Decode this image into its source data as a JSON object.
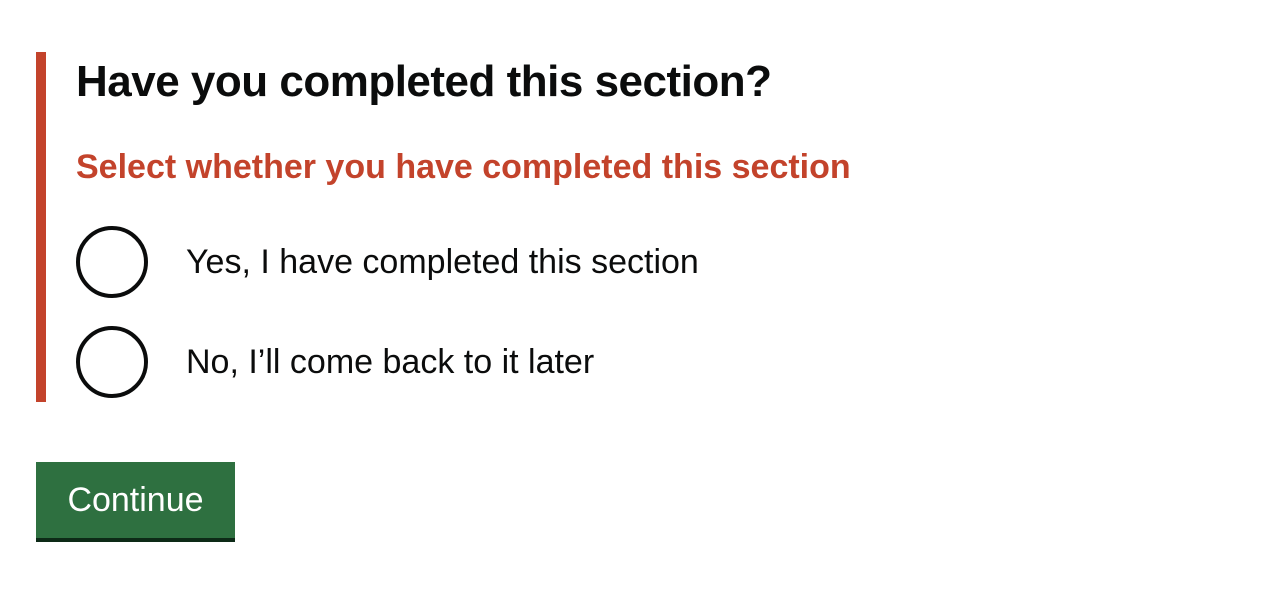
{
  "question": {
    "heading": "Have you completed this section?",
    "error_message": "Select whether you have completed this section"
  },
  "options": [
    {
      "label": "Yes, I have completed this section",
      "selected": false
    },
    {
      "label": "No, I’ll come back to it later",
      "selected": false
    }
  ],
  "actions": {
    "continue_label": "Continue"
  },
  "colors": {
    "error": "#c3432b",
    "button": "#2e7040",
    "button_shadow": "#0d2a17",
    "text": "#0b0c0c"
  }
}
